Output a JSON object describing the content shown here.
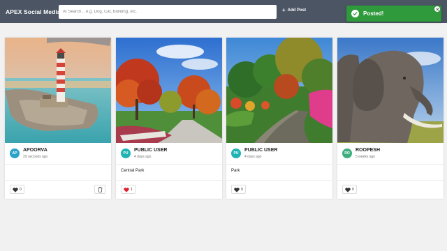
{
  "header": {
    "brand": "APEX Social Media",
    "search_placeholder": "AI Search... e.g. Dog, Cat, Building, etc.",
    "add_post_label": "Add Post"
  },
  "toast": {
    "message": "Posted!",
    "color": "#2f9a3c"
  },
  "posts": [
    {
      "image": "lighthouse",
      "initials": "AP",
      "avatar_color": "#2aa2c9",
      "author": "APOORVA",
      "time": "29 seconds ago",
      "caption": "",
      "likes": "0",
      "liked": false,
      "deletable": true
    },
    {
      "image": "autumn-park",
      "initials": "PU",
      "avatar_color": "#1fb3b3",
      "author": "PUBLIC USER",
      "time": "4 days ago",
      "caption": "Central Park",
      "likes": "1",
      "liked": true,
      "deletable": false
    },
    {
      "image": "park-path",
      "initials": "PU",
      "avatar_color": "#1fb3b3",
      "author": "PUBLIC USER",
      "time": "4 days ago",
      "caption": "Park",
      "likes": "0",
      "liked": false,
      "deletable": false
    },
    {
      "image": "elephant",
      "initials": "RO",
      "avatar_color": "#3fae7f",
      "author": "ROOPESH",
      "time": "5 weeks ago",
      "caption": "",
      "likes": "0",
      "liked": false,
      "deletable": false
    }
  ]
}
